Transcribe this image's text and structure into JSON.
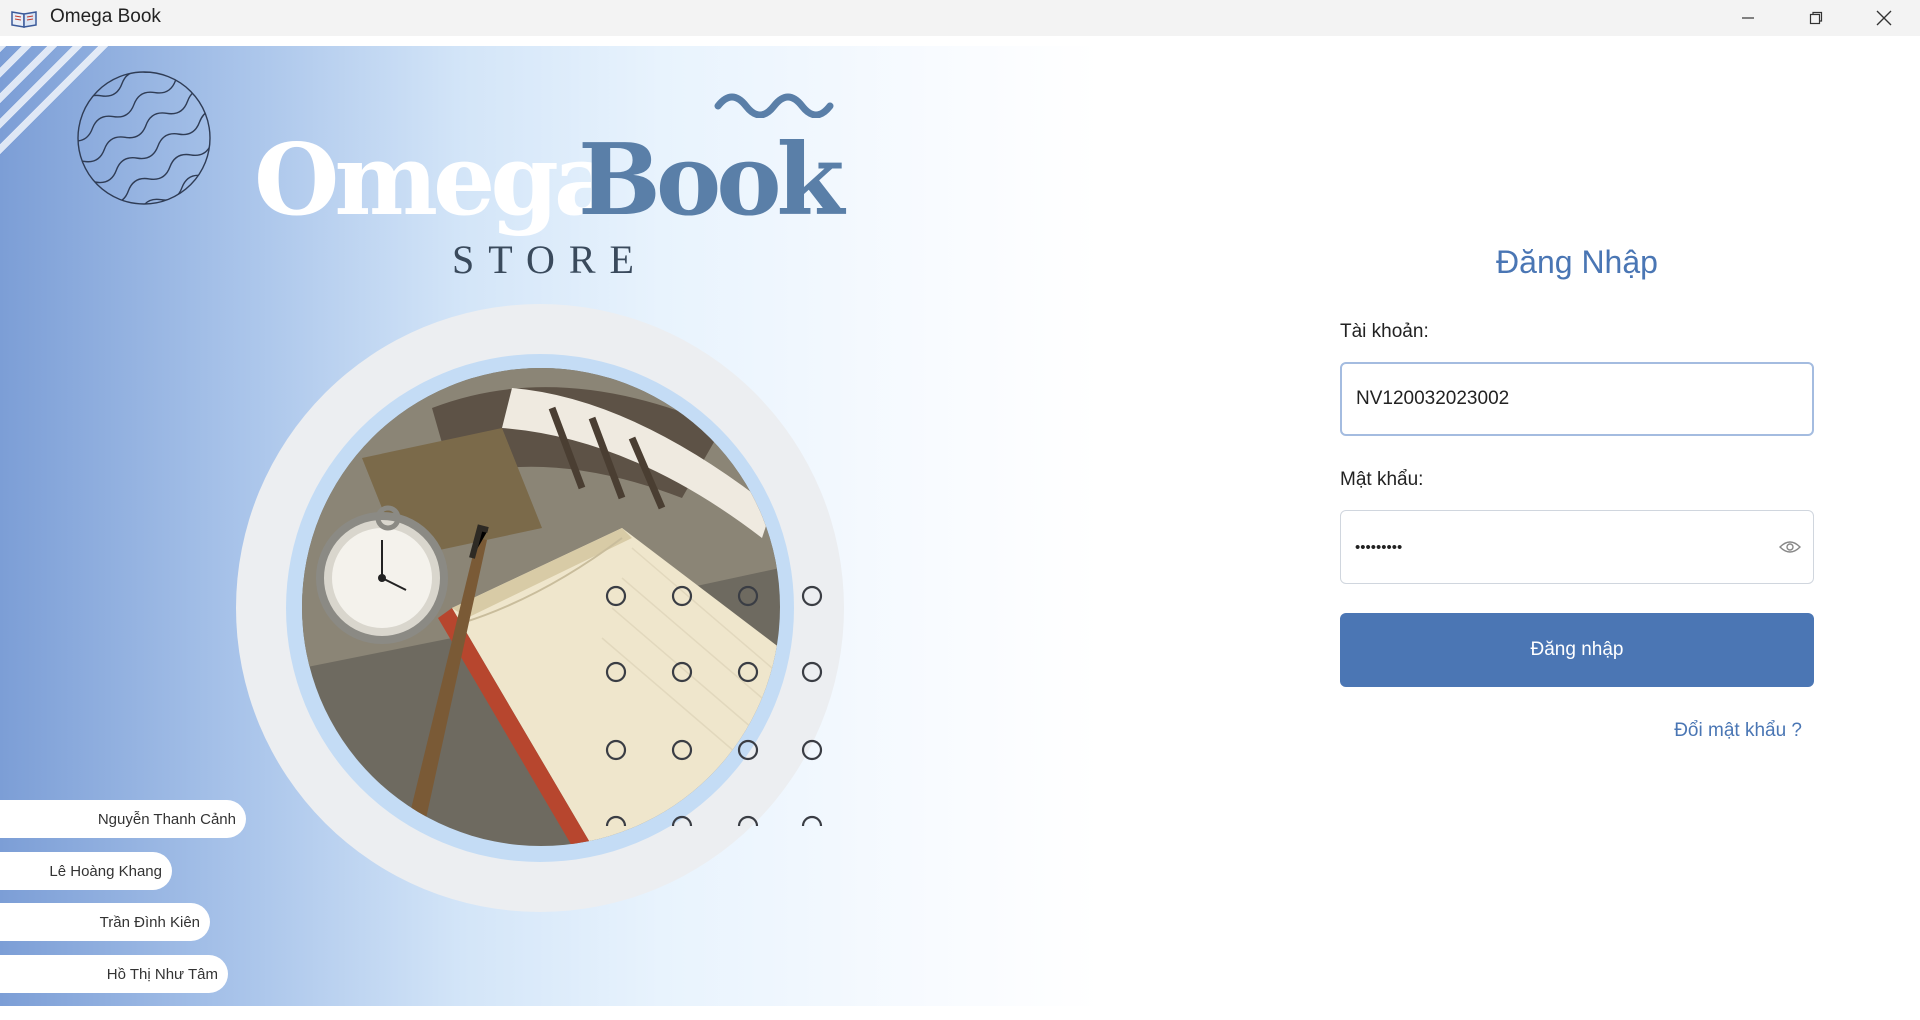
{
  "window": {
    "title": "Omega Book",
    "icon": "book-icon",
    "controls": [
      "minimize-icon",
      "restore-icon",
      "close-icon"
    ]
  },
  "brand": {
    "logo_part1": "Omega",
    "logo_part2": "Book",
    "tagline": "STORE"
  },
  "credits": [
    "Nguyễn Thanh Cảnh",
    "Lê Hoàng Khang",
    "Trần Đình Kiên",
    "Hồ Thị Như Tâm"
  ],
  "login": {
    "title": "Đăng Nhập",
    "username_label": "Tài khoản:",
    "username_value": "NV120032023002",
    "password_label": "Mật khẩu:",
    "password_value": "•••••••••",
    "submit_label": "Đăng nhập",
    "forgot_label": "Đổi mật khẩu ?"
  },
  "colors": {
    "accent": "#4b76b4",
    "logo_book": "#5a7fa8",
    "hero_left": "#7c9ed6"
  }
}
